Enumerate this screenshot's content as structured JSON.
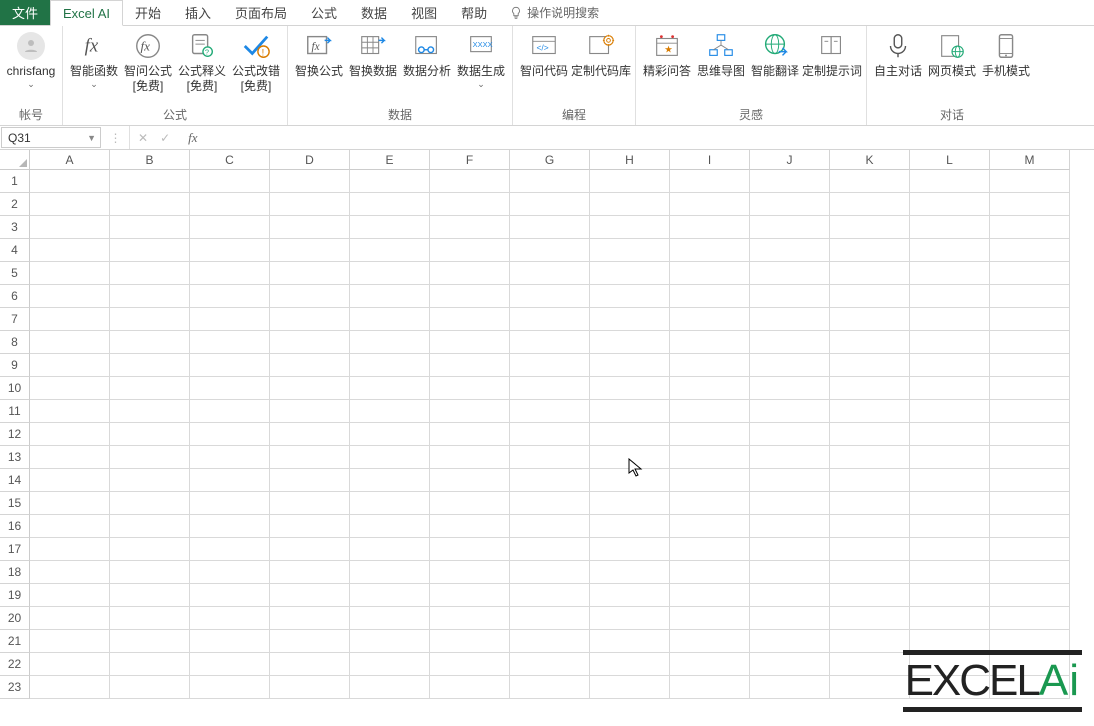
{
  "tabs": {
    "file": "文件",
    "active": "Excel AI",
    "others": [
      "开始",
      "插入",
      "页面布局",
      "公式",
      "数据",
      "视图",
      "帮助"
    ],
    "tellme": "操作说明搜索"
  },
  "ribbon": {
    "account": {
      "user": "chrisfang",
      "group": "帐号"
    },
    "group_formula": {
      "label": "公式",
      "btn1": "智能函数",
      "btn2a": "智问公式",
      "btn2b": "[免费]",
      "btn3a": "公式释义",
      "btn3b": "[免费]",
      "btn4a": "公式改错",
      "btn4b": "[免费]"
    },
    "group_data": {
      "label": "数据",
      "btn1": "智换公式",
      "btn2": "智换数据",
      "btn3": "数据分析",
      "btn4": "数据生成"
    },
    "group_code": {
      "label": "编程",
      "btn1": "智问代码",
      "btn2": "定制代码库"
    },
    "group_insp": {
      "label": "灵感",
      "btn1": "精彩问答",
      "btn2": "思维导图",
      "btn3": "智能翻译",
      "btn4": "定制提示词"
    },
    "group_chat": {
      "label": "对话",
      "btn1": "自主对话",
      "btn2": "网页模式",
      "btn3": "手机模式"
    }
  },
  "formula_bar": {
    "namebox": "Q31",
    "value": ""
  },
  "grid": {
    "columns": [
      "A",
      "B",
      "C",
      "D",
      "E",
      "F",
      "G",
      "H",
      "I",
      "J",
      "K",
      "L",
      "M"
    ],
    "rows": [
      "1",
      "2",
      "3",
      "4",
      "5",
      "6",
      "7",
      "8",
      "9",
      "10",
      "11",
      "12",
      "13",
      "14",
      "15",
      "16",
      "17",
      "18",
      "19",
      "20",
      "21",
      "22",
      "23"
    ]
  },
  "watermark": {
    "part1": "EXCEL",
    "part2": "Ai"
  }
}
